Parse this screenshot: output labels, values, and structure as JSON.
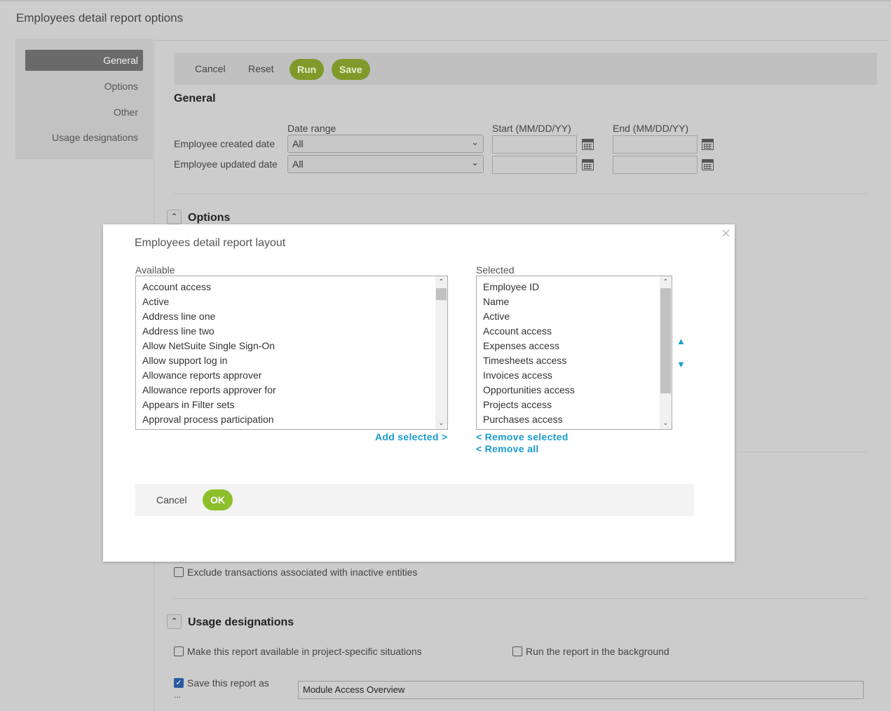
{
  "page": {
    "title": "Employees detail report options"
  },
  "sidebar": {
    "items": [
      {
        "label": "General",
        "active": true
      },
      {
        "label": "Options",
        "active": false
      },
      {
        "label": "Other",
        "active": false
      },
      {
        "label": "Usage designations",
        "active": false
      }
    ]
  },
  "toolbar": {
    "cancel": "Cancel",
    "reset": "Reset",
    "run": "Run",
    "save": "Save"
  },
  "general": {
    "title": "General",
    "date_range_header": "Date range",
    "start_header": "Start (MM/DD/YY)",
    "end_header": "End (MM/DD/YY)",
    "rows": [
      {
        "label": "Employee created date",
        "range": "All",
        "start": "",
        "end": ""
      },
      {
        "label": "Employee updated date",
        "range": "All",
        "start": "",
        "end": ""
      }
    ]
  },
  "options": {
    "title": "Options"
  },
  "other": {
    "exclude_inactive_label": "Exclude transactions associated with inactive entities",
    "exclude_inactive_checked": false
  },
  "usage": {
    "title": "Usage designations",
    "project_specific_label": "Make this report available in project-specific situations",
    "project_specific_checked": false,
    "background_label": "Run the report in the background",
    "background_checked": false,
    "save_as_label": "Save this report as",
    "save_as_ellipsis": "...",
    "save_as_checked": true,
    "save_as_value": "Module Access Overview"
  },
  "modal": {
    "title": "Employees detail report layout",
    "close": "×",
    "available_label": "Available",
    "selected_label": "Selected",
    "available": [
      "Account access",
      "Active",
      "Address line one",
      "Address line two",
      "Allow NetSuite Single Sign-On",
      "Allow support log in",
      "Allowance reports approver",
      "Allowance reports approver for",
      "Appears in Filter sets",
      "Approval process participation"
    ],
    "selected": [
      "Employee ID",
      "Name",
      "Active",
      "Account access",
      "Expenses access",
      "Timesheets access",
      "Invoices access",
      "Opportunities access",
      "Projects access",
      "Purchases access"
    ],
    "add_selected": "Add selected >",
    "remove_selected": "< Remove selected",
    "remove_all": "< Remove all",
    "move_up": "▲",
    "move_down": "▼",
    "cancel": "Cancel",
    "ok": "OK"
  }
}
